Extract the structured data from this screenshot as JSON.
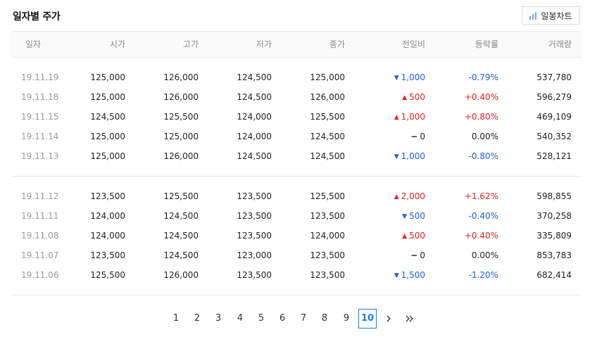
{
  "title": "일자별 주가",
  "chart_button": {
    "label": "일봉차트",
    "icon": "bar-chart-icon"
  },
  "header": [
    "일자",
    "시가",
    "고가",
    "저가",
    "종가",
    "전일비",
    "등락률",
    "거래량"
  ],
  "colors": {
    "up": "#e02020",
    "down": "#1e5fd8",
    "accent": "#2a7dd1"
  },
  "groups": [
    [
      {
        "date": "19.11.19",
        "open": "125,000",
        "high": "126,000",
        "low": "124,500",
        "close": "125,000",
        "dir": "down",
        "diff": "1,000",
        "rate": "-0.79%",
        "volume": "537,780"
      },
      {
        "date": "19.11.18",
        "open": "125,000",
        "high": "126,000",
        "low": "124,500",
        "close": "126,000",
        "dir": "up",
        "diff": "500",
        "rate": "+0.40%",
        "volume": "596,279"
      },
      {
        "date": "19.11.15",
        "open": "124,500",
        "high": "125,500",
        "low": "124,000",
        "close": "125,500",
        "dir": "up",
        "diff": "1,000",
        "rate": "+0.80%",
        "volume": "469,109"
      },
      {
        "date": "19.11.14",
        "open": "125,000",
        "high": "125,000",
        "low": "124,000",
        "close": "124,500",
        "dir": "flat",
        "diff": "0",
        "rate": "0.00%",
        "volume": "540,352"
      },
      {
        "date": "19.11.13",
        "open": "125,000",
        "high": "126,000",
        "low": "124,500",
        "close": "124,500",
        "dir": "down",
        "diff": "1,000",
        "rate": "-0.80%",
        "volume": "528,121"
      }
    ],
    [
      {
        "date": "19.11.12",
        "open": "123,500",
        "high": "125,500",
        "low": "123,500",
        "close": "125,500",
        "dir": "up",
        "diff": "2,000",
        "rate": "+1.62%",
        "volume": "598,855"
      },
      {
        "date": "19.11.11",
        "open": "124,000",
        "high": "124,500",
        "low": "123,500",
        "close": "123,500",
        "dir": "down",
        "diff": "500",
        "rate": "-0.40%",
        "volume": "370,258"
      },
      {
        "date": "19.11.08",
        "open": "124,000",
        "high": "124,500",
        "low": "123,500",
        "close": "124,000",
        "dir": "up",
        "diff": "500",
        "rate": "+0.40%",
        "volume": "335,809"
      },
      {
        "date": "19.11.07",
        "open": "123,500",
        "high": "124,500",
        "low": "123,000",
        "close": "123,500",
        "dir": "flat",
        "diff": "0",
        "rate": "0.00%",
        "volume": "853,783"
      },
      {
        "date": "19.11.06",
        "open": "125,500",
        "high": "126,000",
        "low": "123,500",
        "close": "123,500",
        "dir": "down",
        "diff": "1,500",
        "rate": "-1.20%",
        "volume": "682,414"
      }
    ]
  ],
  "pagination": {
    "pages": [
      "1",
      "2",
      "3",
      "4",
      "5",
      "6",
      "7",
      "8",
      "9",
      "10"
    ],
    "current": "10",
    "next_icon": "chevron-right-icon",
    "last_icon": "double-chevron-right-icon"
  }
}
